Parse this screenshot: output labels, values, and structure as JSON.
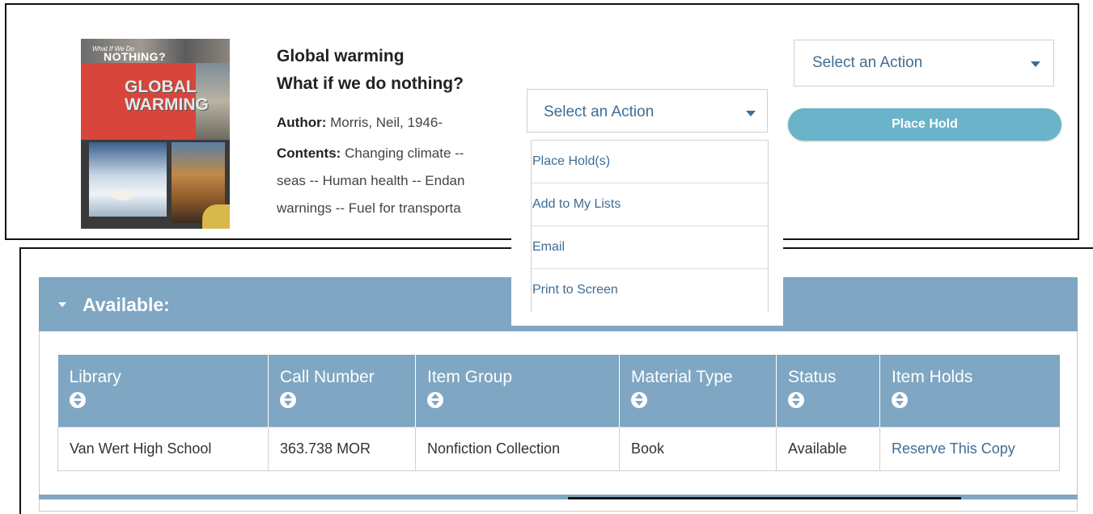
{
  "cover": {
    "series_text": "What If We Do",
    "series_word": "NOTHING?",
    "title_line1": "GLOBAL",
    "title_line2": "WARMING"
  },
  "record": {
    "title": "Global warming",
    "subtitle": "What if we do nothing?",
    "author_label": "Author:",
    "author_value": "Morris, Neil, 1946-",
    "contents_label": "Contents:",
    "contents_line1": "Changing climate --",
    "contents_line2": "seas -- Human health -- Endan",
    "contents_line3": "warnings -- Fuel for transporta"
  },
  "actions_right": {
    "select_label": "Select an Action",
    "place_hold": "Place Hold"
  },
  "actions_dropdown": {
    "select_label": "Select an Action",
    "options": [
      "Place Hold(s)",
      "Add to My Lists",
      "Email",
      "Print to Screen"
    ]
  },
  "availability": {
    "header": "Available:",
    "columns": [
      "Library",
      "Call Number",
      "Item Group",
      "Material Type",
      "Status",
      "Item Holds"
    ],
    "rows": [
      [
        "Van Wert High School",
        "363.738 MOR",
        "Nonfiction Collection",
        "Book",
        "Available",
        "Reserve This Copy"
      ]
    ]
  },
  "colors": {
    "accent_blue": "#7fa6c2",
    "button_teal": "#6ab3c8",
    "link_blue": "#3f6d93"
  }
}
